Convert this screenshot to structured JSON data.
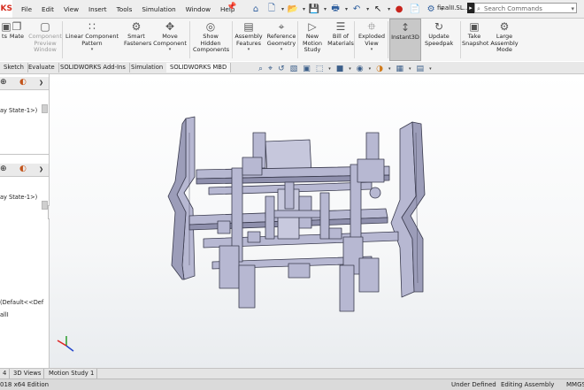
{
  "app": {
    "logo_text": "KS",
    "document_title": "finalII.SL..."
  },
  "menu": [
    "File",
    "Edit",
    "View",
    "Insert",
    "Tools",
    "Simulation",
    "Window",
    "Help"
  ],
  "search": {
    "placeholder": "Search Commands"
  },
  "ribbon": [
    {
      "label": "ts",
      "icon": "insert-components-icon",
      "dim": false
    },
    {
      "label": "Mate",
      "icon": "mate-icon",
      "dim": false
    },
    {
      "label": "Component\nPreview\nWindow",
      "icon": "preview-window-icon",
      "dim": true
    },
    {
      "label": "Linear Component\nPattern",
      "icon": "linear-pattern-icon",
      "dim": false
    },
    {
      "label": "Smart\nFasteners",
      "icon": "smart-fasteners-icon",
      "dim": false
    },
    {
      "label": "Move\nComponent",
      "icon": "move-component-icon",
      "dim": false
    },
    {
      "label": "Show\nHidden\nComponents",
      "icon": "show-hidden-icon",
      "dim": false
    },
    {
      "label": "Assembly\nFeatures",
      "icon": "assembly-features-icon",
      "dim": false
    },
    {
      "label": "Reference\nGeometry",
      "icon": "reference-geometry-icon",
      "dim": false
    },
    {
      "label": "New\nMotion\nStudy",
      "icon": "motion-study-icon",
      "dim": false
    },
    {
      "label": "Bill of\nMaterials",
      "icon": "bom-icon",
      "dim": false
    },
    {
      "label": "Exploded\nView",
      "icon": "exploded-view-icon",
      "dim": false
    },
    {
      "label": "Instant3D",
      "icon": "instant3d-icon",
      "dim": false,
      "active": true
    },
    {
      "label": "Update\nSpeedpak",
      "icon": "speedpak-icon",
      "dim": false
    },
    {
      "label": "Take\nSnapshot",
      "icon": "snapshot-icon",
      "dim": false
    },
    {
      "label": "Large\nAssembly\nMode",
      "icon": "large-assembly-icon",
      "dim": false
    }
  ],
  "command_tabs": [
    "Sketch",
    "Evaluate",
    "SOLIDWORKS Add-Ins",
    "Simulation",
    "SOLIDWORKS MBD"
  ],
  "panel": {
    "upper_text": "ay State-1>)",
    "lower_text": "ay State-1>)",
    "tree_line1": "(Default<<Def",
    "tree_line2": "allI"
  },
  "bottom_tabs": [
    "4",
    "3D Views",
    "Motion Study 1"
  ],
  "status": {
    "left": "018 x64 Edition",
    "under_defined": "Under Defined",
    "editing": "Editing Assembly",
    "units": "MMGS"
  },
  "colors": {
    "model_fill": "#b7b8d2",
    "model_edge": "#3a3b4e",
    "accent": "#d52b1e"
  }
}
